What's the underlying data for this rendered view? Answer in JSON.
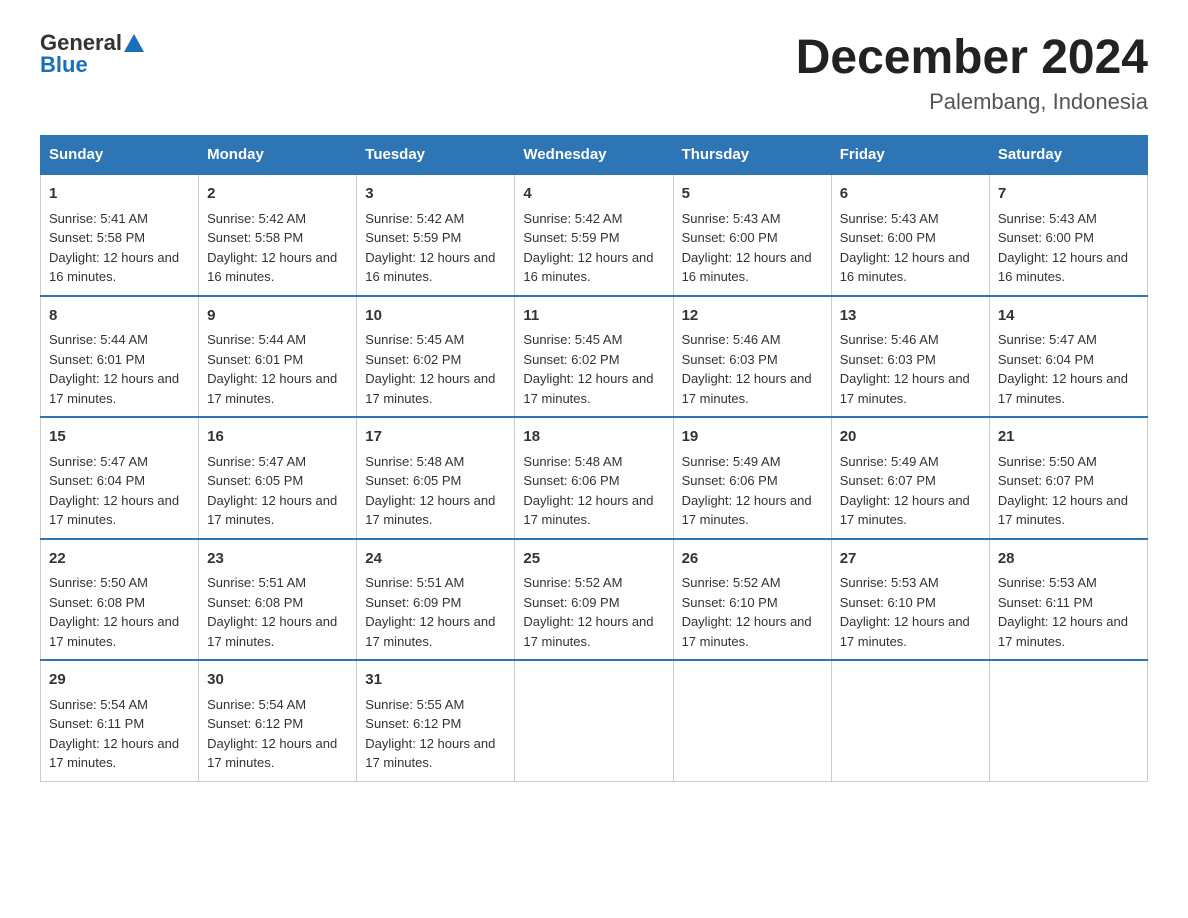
{
  "header": {
    "title": "December 2024",
    "subtitle": "Palembang, Indonesia"
  },
  "logo": {
    "general": "General",
    "blue": "Blue"
  },
  "days": [
    "Sunday",
    "Monday",
    "Tuesday",
    "Wednesday",
    "Thursday",
    "Friday",
    "Saturday"
  ],
  "weeks": [
    [
      {
        "day": "1",
        "sunrise": "5:41 AM",
        "sunset": "5:58 PM",
        "daylight": "12 hours and 16 minutes."
      },
      {
        "day": "2",
        "sunrise": "5:42 AM",
        "sunset": "5:58 PM",
        "daylight": "12 hours and 16 minutes."
      },
      {
        "day": "3",
        "sunrise": "5:42 AM",
        "sunset": "5:59 PM",
        "daylight": "12 hours and 16 minutes."
      },
      {
        "day": "4",
        "sunrise": "5:42 AM",
        "sunset": "5:59 PM",
        "daylight": "12 hours and 16 minutes."
      },
      {
        "day": "5",
        "sunrise": "5:43 AM",
        "sunset": "6:00 PM",
        "daylight": "12 hours and 16 minutes."
      },
      {
        "day": "6",
        "sunrise": "5:43 AM",
        "sunset": "6:00 PM",
        "daylight": "12 hours and 16 minutes."
      },
      {
        "day": "7",
        "sunrise": "5:43 AM",
        "sunset": "6:00 PM",
        "daylight": "12 hours and 16 minutes."
      }
    ],
    [
      {
        "day": "8",
        "sunrise": "5:44 AM",
        "sunset": "6:01 PM",
        "daylight": "12 hours and 17 minutes."
      },
      {
        "day": "9",
        "sunrise": "5:44 AM",
        "sunset": "6:01 PM",
        "daylight": "12 hours and 17 minutes."
      },
      {
        "day": "10",
        "sunrise": "5:45 AM",
        "sunset": "6:02 PM",
        "daylight": "12 hours and 17 minutes."
      },
      {
        "day": "11",
        "sunrise": "5:45 AM",
        "sunset": "6:02 PM",
        "daylight": "12 hours and 17 minutes."
      },
      {
        "day": "12",
        "sunrise": "5:46 AM",
        "sunset": "6:03 PM",
        "daylight": "12 hours and 17 minutes."
      },
      {
        "day": "13",
        "sunrise": "5:46 AM",
        "sunset": "6:03 PM",
        "daylight": "12 hours and 17 minutes."
      },
      {
        "day": "14",
        "sunrise": "5:47 AM",
        "sunset": "6:04 PM",
        "daylight": "12 hours and 17 minutes."
      }
    ],
    [
      {
        "day": "15",
        "sunrise": "5:47 AM",
        "sunset": "6:04 PM",
        "daylight": "12 hours and 17 minutes."
      },
      {
        "day": "16",
        "sunrise": "5:47 AM",
        "sunset": "6:05 PM",
        "daylight": "12 hours and 17 minutes."
      },
      {
        "day": "17",
        "sunrise": "5:48 AM",
        "sunset": "6:05 PM",
        "daylight": "12 hours and 17 minutes."
      },
      {
        "day": "18",
        "sunrise": "5:48 AM",
        "sunset": "6:06 PM",
        "daylight": "12 hours and 17 minutes."
      },
      {
        "day": "19",
        "sunrise": "5:49 AM",
        "sunset": "6:06 PM",
        "daylight": "12 hours and 17 minutes."
      },
      {
        "day": "20",
        "sunrise": "5:49 AM",
        "sunset": "6:07 PM",
        "daylight": "12 hours and 17 minutes."
      },
      {
        "day": "21",
        "sunrise": "5:50 AM",
        "sunset": "6:07 PM",
        "daylight": "12 hours and 17 minutes."
      }
    ],
    [
      {
        "day": "22",
        "sunrise": "5:50 AM",
        "sunset": "6:08 PM",
        "daylight": "12 hours and 17 minutes."
      },
      {
        "day": "23",
        "sunrise": "5:51 AM",
        "sunset": "6:08 PM",
        "daylight": "12 hours and 17 minutes."
      },
      {
        "day": "24",
        "sunrise": "5:51 AM",
        "sunset": "6:09 PM",
        "daylight": "12 hours and 17 minutes."
      },
      {
        "day": "25",
        "sunrise": "5:52 AM",
        "sunset": "6:09 PM",
        "daylight": "12 hours and 17 minutes."
      },
      {
        "day": "26",
        "sunrise": "5:52 AM",
        "sunset": "6:10 PM",
        "daylight": "12 hours and 17 minutes."
      },
      {
        "day": "27",
        "sunrise": "5:53 AM",
        "sunset": "6:10 PM",
        "daylight": "12 hours and 17 minutes."
      },
      {
        "day": "28",
        "sunrise": "5:53 AM",
        "sunset": "6:11 PM",
        "daylight": "12 hours and 17 minutes."
      }
    ],
    [
      {
        "day": "29",
        "sunrise": "5:54 AM",
        "sunset": "6:11 PM",
        "daylight": "12 hours and 17 minutes."
      },
      {
        "day": "30",
        "sunrise": "5:54 AM",
        "sunset": "6:12 PM",
        "daylight": "12 hours and 17 minutes."
      },
      {
        "day": "31",
        "sunrise": "5:55 AM",
        "sunset": "6:12 PM",
        "daylight": "12 hours and 17 minutes."
      },
      null,
      null,
      null,
      null
    ]
  ],
  "labels": {
    "sunrise": "Sunrise:",
    "sunset": "Sunset:",
    "daylight": "Daylight:"
  }
}
